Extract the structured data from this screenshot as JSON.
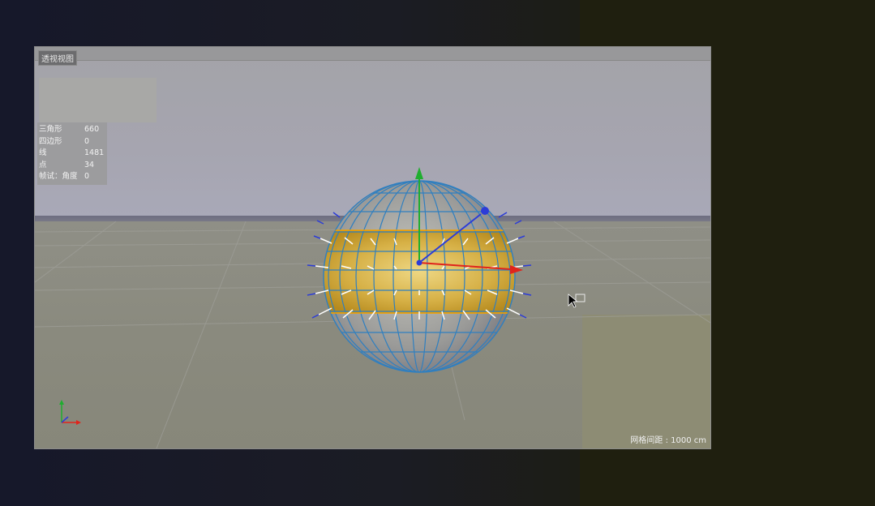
{
  "viewport": {
    "title": "透视视图",
    "grid_spacing": "网格间距 : 1000 cm"
  },
  "stats": [
    {
      "label": "三角形",
      "value": "660"
    },
    {
      "label": "四边形",
      "value": "0"
    },
    {
      "label": "线",
      "value": "1481"
    },
    {
      "label": "点",
      "value": "34"
    },
    {
      "label": "帧试：角度",
      "value": "0"
    }
  ],
  "colors": {
    "selection": "#e8a820",
    "wire": "#2f7fc0",
    "axis_x": "#e0241c",
    "axis_y": "#1fae2f",
    "axis_z": "#2c3cd8"
  },
  "icons": [
    "axis-gizmo-icon",
    "mouse-cursor-icon",
    "move-tool-icon"
  ]
}
